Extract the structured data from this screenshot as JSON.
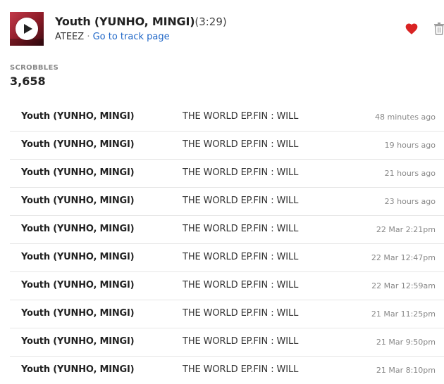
{
  "header": {
    "title": "Youth (YUNHO, MINGI)",
    "duration": "(3:29)",
    "artist": "ATEEZ",
    "separator": "·",
    "link_label": "Go to track page"
  },
  "colors": {
    "accent_red": "#d92323",
    "link_blue": "#1e66c7"
  },
  "icons": {
    "play": "play-icon",
    "love": "heart-icon",
    "delete": "trash-icon"
  },
  "stats": {
    "label": "SCROBBLES",
    "value": "3,658"
  },
  "scrobbles": [
    {
      "track": "Youth (YUNHO, MINGI)",
      "album": "THE WORLD EP.FIN : WILL",
      "time": "48 minutes ago"
    },
    {
      "track": "Youth (YUNHO, MINGI)",
      "album": "THE WORLD EP.FIN : WILL",
      "time": "19 hours ago"
    },
    {
      "track": "Youth (YUNHO, MINGI)",
      "album": "THE WORLD EP.FIN : WILL",
      "time": "21 hours ago"
    },
    {
      "track": "Youth (YUNHO, MINGI)",
      "album": "THE WORLD EP.FIN : WILL",
      "time": "23 hours ago"
    },
    {
      "track": "Youth (YUNHO, MINGI)",
      "album": "THE WORLD EP.FIN : WILL",
      "time": "22 Mar 2:21pm"
    },
    {
      "track": "Youth (YUNHO, MINGI)",
      "album": "THE WORLD EP.FIN : WILL",
      "time": "22 Mar 12:47pm"
    },
    {
      "track": "Youth (YUNHO, MINGI)",
      "album": "THE WORLD EP.FIN : WILL",
      "time": "22 Mar 12:59am"
    },
    {
      "track": "Youth (YUNHO, MINGI)",
      "album": "THE WORLD EP.FIN : WILL",
      "time": "21 Mar 11:25pm"
    },
    {
      "track": "Youth (YUNHO, MINGI)",
      "album": "THE WORLD EP.FIN : WILL",
      "time": "21 Mar 9:50pm"
    },
    {
      "track": "Youth (YUNHO, MINGI)",
      "album": "THE WORLD EP.FIN : WILL",
      "time": "21 Mar 8:10pm"
    }
  ]
}
